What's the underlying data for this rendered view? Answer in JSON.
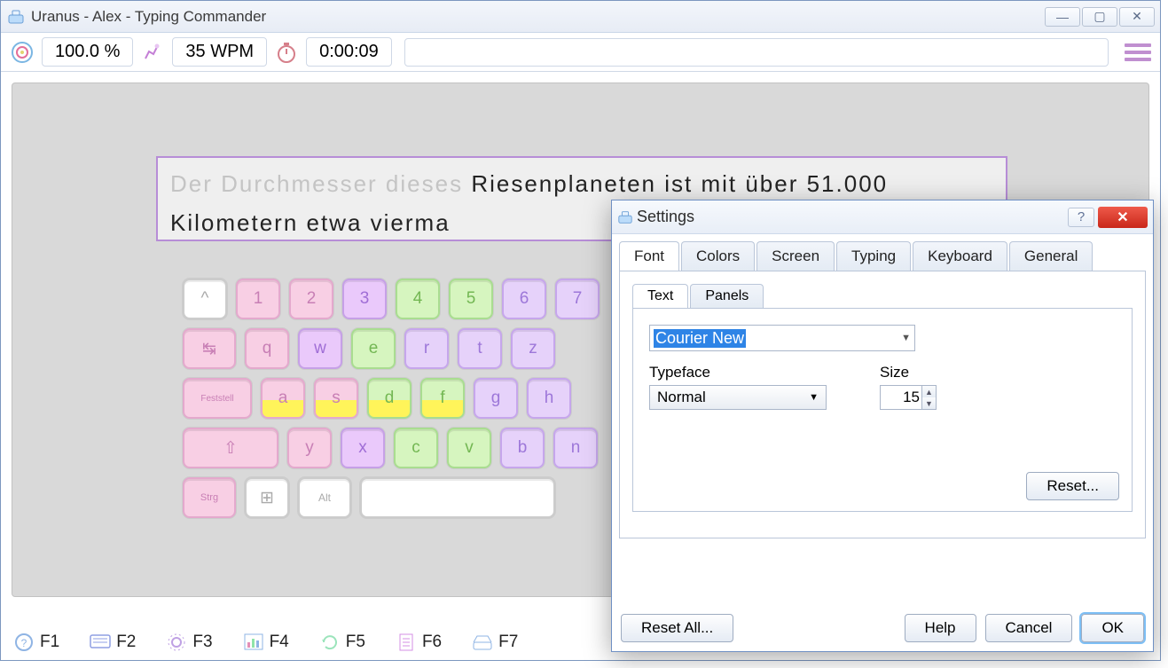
{
  "window": {
    "title": "Uranus - Alex - Typing Commander"
  },
  "stats": {
    "accuracy": "100.0 %",
    "speed": "35 WPM",
    "time": "0:00:09"
  },
  "text": {
    "typed": "Der Durchmesser dieses ",
    "rest": "Riesenplaneten ist mit über 51.000 Kilometern etwa vierma"
  },
  "keyboard": {
    "row1": [
      "^",
      "1",
      "2",
      "3",
      "4",
      "5",
      "6",
      "7"
    ],
    "row2_lead": "↹",
    "row2": [
      "q",
      "w",
      "e",
      "r",
      "t",
      "z"
    ],
    "row3_lead": "Feststell",
    "row3": [
      "a",
      "s",
      "d",
      "f",
      "g",
      "h"
    ],
    "row4_lead": "⇧",
    "row4": [
      "y",
      "x",
      "c",
      "v",
      "b",
      "n"
    ],
    "row5": [
      "Strg",
      "⊞",
      "Alt"
    ]
  },
  "fkeys": [
    {
      "label": "F1",
      "icon": "help"
    },
    {
      "label": "F2",
      "icon": "keyboard"
    },
    {
      "label": "F3",
      "icon": "gear"
    },
    {
      "label": "F4",
      "icon": "chart"
    },
    {
      "label": "F5",
      "icon": "reload"
    },
    {
      "label": "F6",
      "icon": "doc"
    },
    {
      "label": "F7",
      "icon": "tray"
    }
  ],
  "settings": {
    "title": "Settings",
    "tabs": [
      "Font",
      "Colors",
      "Screen",
      "Typing",
      "Keyboard",
      "General"
    ],
    "subtabs": [
      "Text",
      "Panels"
    ],
    "font_name": "Courier New",
    "typeface_label": "Typeface",
    "size_label": "Size",
    "typeface": "Normal",
    "size": "15",
    "reset": "Reset...",
    "reset_all": "Reset All...",
    "help": "Help",
    "cancel": "Cancel",
    "ok": "OK"
  }
}
